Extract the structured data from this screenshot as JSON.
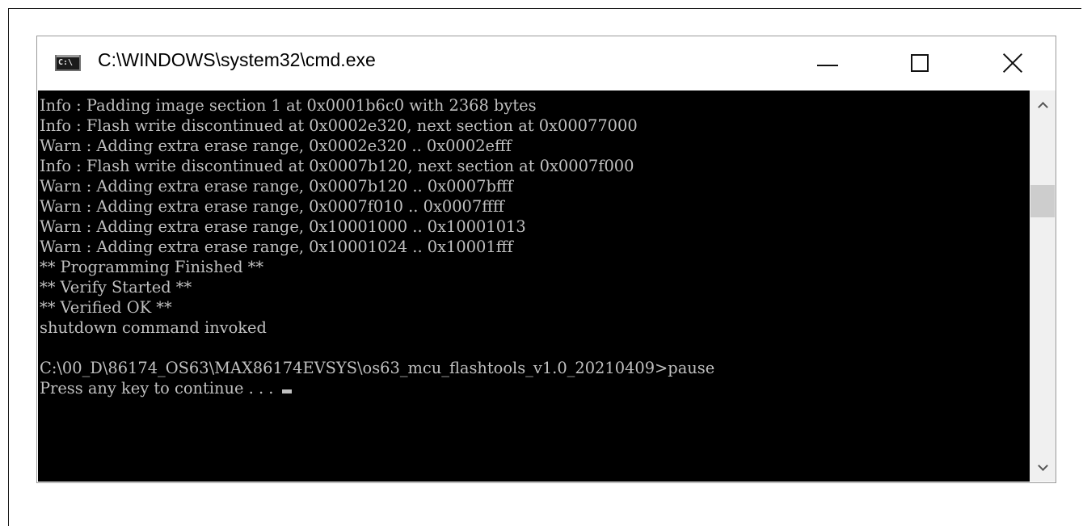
{
  "window": {
    "title": "C:\\WINDOWS\\system32\\cmd.exe",
    "icon_text": "C:\\",
    "controls": {
      "minimize": "minimize-icon",
      "maximize": "maximize-icon",
      "close": "close-icon"
    }
  },
  "console": {
    "lines": [
      "Info : Padding image section 1 at 0x0001b6c0 with 2368 bytes",
      "Info : Flash write discontinued at 0x0002e320, next section at 0x00077000",
      "Warn : Adding extra erase range, 0x0002e320 .. 0x0002efff",
      "Info : Flash write discontinued at 0x0007b120, next section at 0x0007f000",
      "Warn : Adding extra erase range, 0x0007b120 .. 0x0007bfff",
      "Warn : Adding extra erase range, 0x0007f010 .. 0x0007ffff",
      "Warn : Adding extra erase range, 0x10001000 .. 0x10001013",
      "Warn : Adding extra erase range, 0x10001024 .. 0x10001fff",
      "** Programming Finished **",
      "** Verify Started **",
      "** Verified OK **",
      "shutdown command invoked",
      "",
      "C:\\00_D\\86174_OS63\\MAX86174EVSYS\\os63_mcu_flashtools_v1.0_20210409>pause",
      "Press any key to continue . . . "
    ],
    "text_color": "#c0c0c0",
    "background": "#000000"
  },
  "scrollbar": {
    "up_icon": "chevron-up-icon",
    "down_icon": "chevron-down-icon"
  }
}
